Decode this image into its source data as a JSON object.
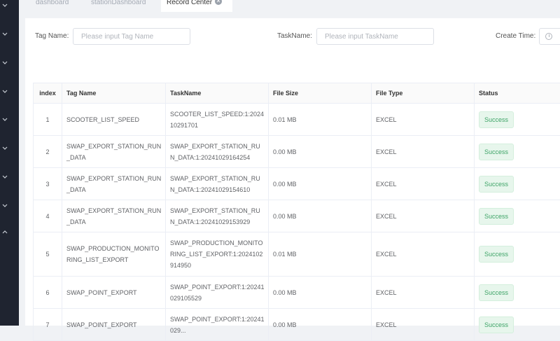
{
  "tabs": [
    {
      "label": "dashboard",
      "active": false
    },
    {
      "label": "stationDashboard",
      "active": false
    },
    {
      "label": "Record Center",
      "active": true
    }
  ],
  "filters": {
    "tag_name_label": "Tag Name:",
    "tag_name_placeholder": "Please input Tag Name",
    "task_name_label": "TaskName:",
    "task_name_placeholder": "Please input TaskName",
    "create_time_label": "Create Time:"
  },
  "table": {
    "headers": [
      "index",
      "Tag Name",
      "TaskName",
      "File Size",
      "File Type",
      "Status"
    ],
    "rows": [
      {
        "index": "1",
        "tag": "SCOOTER_LIST_SPEED",
        "task": "SCOOTER_LIST_SPEED:1:2024\n10291701",
        "size": "0.01 MB",
        "type": "EXCEL",
        "status": "Success"
      },
      {
        "index": "2",
        "tag": "SWAP_EXPORT_STATION_RUN\n_DATA",
        "task": "SWAP_EXPORT_STATION_RU\nN_DATA:1:20241029164254",
        "size": "0.00 MB",
        "type": "EXCEL",
        "status": "Success"
      },
      {
        "index": "3",
        "tag": "SWAP_EXPORT_STATION_RUN\n_DATA",
        "task": "SWAP_EXPORT_STATION_RU\nN_DATA:1:20241029154610",
        "size": "0.00 MB",
        "type": "EXCEL",
        "status": "Success"
      },
      {
        "index": "4",
        "tag": "SWAP_EXPORT_STATION_RUN\n_DATA",
        "task": "SWAP_EXPORT_STATION_RU\nN_DATA:1:20241029153929",
        "size": "0.00 MB",
        "type": "EXCEL",
        "status": "Success"
      },
      {
        "index": "5",
        "tag": "SWAP_PRODUCTION_MONITO\nRING_LIST_EXPORT",
        "task": "SWAP_PRODUCTION_MONITO\nRING_LIST_EXPORT:1:2024102\n914950",
        "size": "0.01 MB",
        "type": "EXCEL",
        "status": "Success"
      },
      {
        "index": "6",
        "tag": "SWAP_POINT_EXPORT",
        "task": "SWAP_POINT_EXPORT:1:20241\n029105529",
        "size": "0.00 MB",
        "type": "EXCEL",
        "status": "Success"
      },
      {
        "index": "7",
        "tag": "SWAP_POINT_EXPORT",
        "task": "SWAP_POINT_EXPORT:1:20241\n029...",
        "size": "0.00 MB",
        "type": "EXCEL",
        "status": "Success"
      }
    ]
  },
  "icons": {
    "sidebar": "chevron-down-icon",
    "close": "close-icon",
    "time": "clock-icon"
  }
}
